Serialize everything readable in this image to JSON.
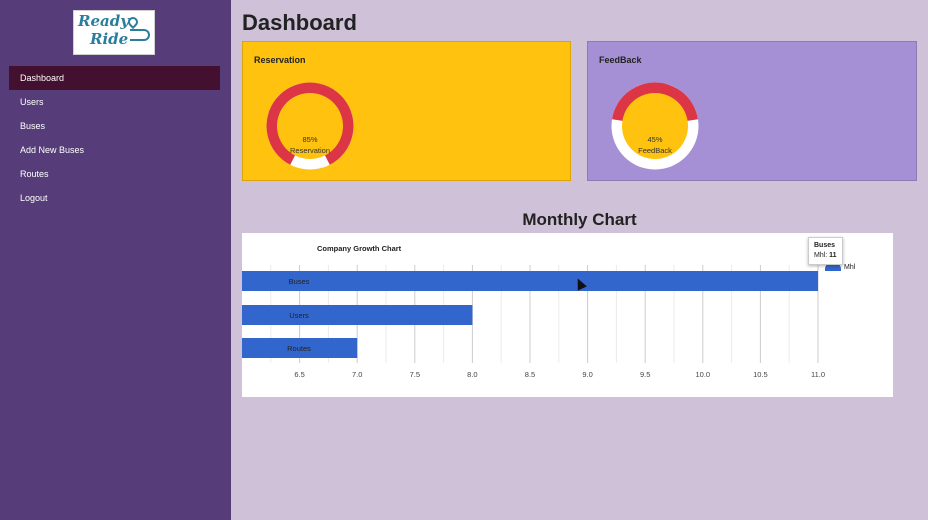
{
  "logo": {
    "line1": "Ready",
    "line2": "Ride"
  },
  "sidebar": {
    "items": [
      {
        "label": "Dashboard",
        "active": true
      },
      {
        "label": "Users"
      },
      {
        "label": "Buses"
      },
      {
        "label": "Add New Buses"
      },
      {
        "label": "Routes"
      },
      {
        "label": "Logout"
      }
    ]
  },
  "header": {
    "title": "Dashboard"
  },
  "cards": {
    "reservation": {
      "title": "Reservation",
      "percent": 85,
      "percent_label": "85%",
      "label": "Reservation"
    },
    "feedback": {
      "title": "FeedBack",
      "percent": 45,
      "percent_label": "45%",
      "label": "FeedBack"
    }
  },
  "colors": {
    "sidebar": "#563d79",
    "nav_active": "#44102f",
    "reservation_card": "#ffc20e",
    "feedback_card": "#a690d5",
    "donut_ring": "#dc3545",
    "donut_center": "#ffc20e",
    "bar": "#3366cc"
  },
  "monthly_chart": {
    "section_title": "Monthly Chart"
  },
  "chart_data": {
    "type": "bar",
    "orientation": "horizontal",
    "title": "Company Growth Chart",
    "categories": [
      "Buses",
      "Users",
      "Routes"
    ],
    "series": [
      {
        "name": "Mhl",
        "values": [
          11,
          8,
          7
        ]
      }
    ],
    "xlim": [
      6.0,
      11.0
    ],
    "xticks": [
      "6.5",
      "7.0",
      "7.5",
      "8.0",
      "8.5",
      "9.0",
      "9.5",
      "10.0",
      "10.5",
      "11.0"
    ],
    "grid": true,
    "legend": "top-right",
    "tooltip": {
      "title": "Buses",
      "series": "Mhl",
      "value": "11"
    }
  }
}
